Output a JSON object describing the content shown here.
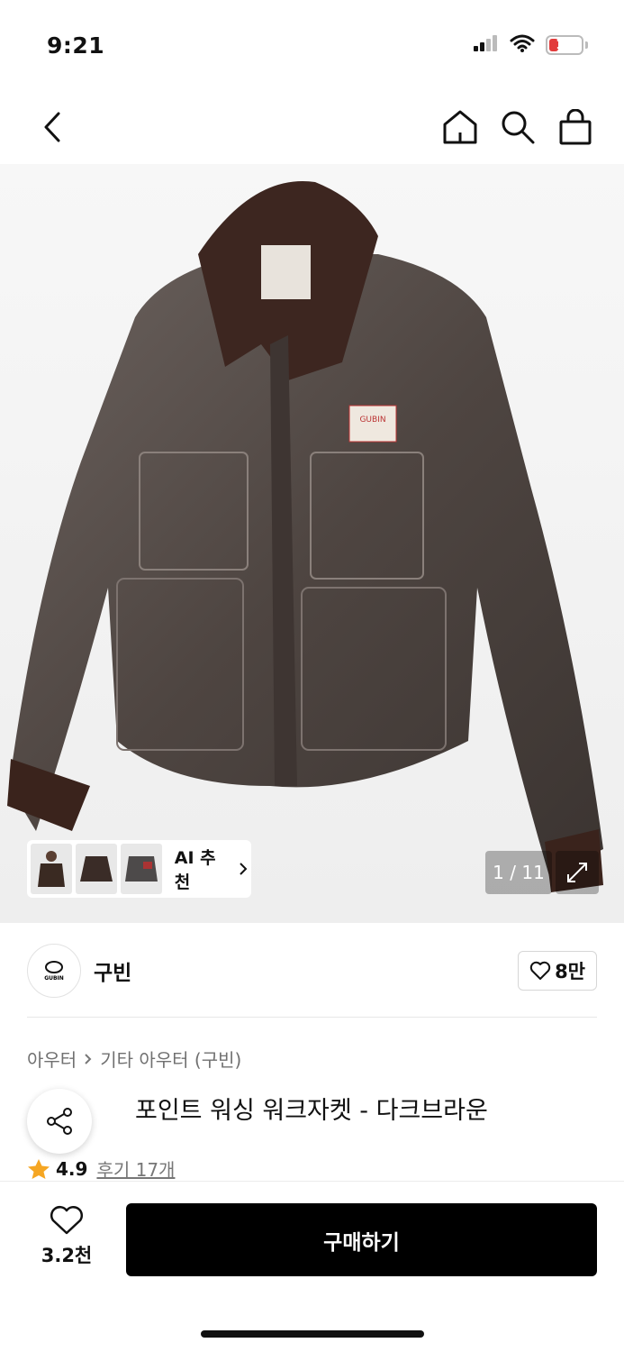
{
  "status_bar": {
    "time": "9:21",
    "battery": "10",
    "battery_color": "#e23b3b"
  },
  "header": {
    "icons": [
      "back-icon",
      "home-icon",
      "search-icon",
      "shopping-bag-icon"
    ]
  },
  "gallery": {
    "page_counter": "1 / 11",
    "ai_recommend_label": "AI 추천",
    "jacket_label_text": "GUBIN"
  },
  "brand": {
    "name": "구빈",
    "logo_text": "GUBIN",
    "likes": "8만"
  },
  "breadcrumb": {
    "category": "아우터",
    "subcategory": "기타 아우터 (구빈)"
  },
  "product": {
    "title": "포인트 워싱 워크자켓 - 다크브라운",
    "rating": "4.9",
    "reviews": "후기 17개"
  },
  "bottom_bar": {
    "wish_count": "3.2천",
    "buy_label": "구매하기"
  },
  "colors": {
    "accent_star": "#f5a623",
    "buy_button": "#000000"
  }
}
